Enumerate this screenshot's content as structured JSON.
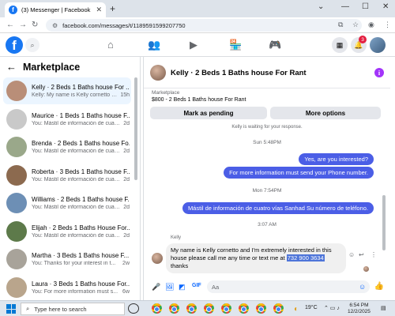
{
  "browser": {
    "tab_title": "(3) Messenger | Facebook",
    "tab_favicon": "f",
    "url": "facebook.com/messages/t/1189591599207750"
  },
  "fbnav": {
    "logo": "f",
    "notification_count": "3"
  },
  "marketplace": {
    "title": "Marketplace",
    "conversations": [
      {
        "name": "Kelly · 2 Beds 1 Baths house For ...",
        "preview": "Kelly: My name is Kelly cornetto a...",
        "time": "15h",
        "active": true,
        "avatar_color": "#b98e78"
      },
      {
        "name": "Maurice · 1 Beds 1 Baths house F...",
        "preview": "You: Mástil de información de cuatro...",
        "time": "2d",
        "active": false,
        "avatar_color": "#c9c9c9"
      },
      {
        "name": "Brenda · 2 Beds 1 Baths house Fo...",
        "preview": "You: Mástil de información de cuatro...",
        "time": "2d",
        "active": false,
        "avatar_color": "#9aa88a"
      },
      {
        "name": "Roberta · 3 Beds 1 Baths house F...",
        "preview": "You: Mástil de información de cuatro...",
        "time": "2d",
        "active": false,
        "avatar_color": "#8c6a4f"
      },
      {
        "name": "Williams · 2 Beds 1 Baths house F...",
        "preview": "You: Mástil de información de cuatro...",
        "time": "2d",
        "active": false,
        "avatar_color": "#6d8fb5"
      },
      {
        "name": "Elijah · 2 Beds 1 Baths House For...",
        "preview": "You: Mástil de información de cuatro...",
        "time": "2d",
        "active": false,
        "avatar_color": "#5d7a4a"
      },
      {
        "name": "Martha · 3 Beds 1 Baths house F...",
        "preview": "You: Thanks for your interest in t...",
        "time": "2w",
        "active": false,
        "avatar_color": "#a8a39a"
      },
      {
        "name": "Laura · 3 Beds 1 Baths house For...",
        "preview": "You: For more information must s...",
        "time": "6w",
        "active": false,
        "avatar_color": "#b9a58c"
      }
    ]
  },
  "chat": {
    "title": "Kelly · 2 Beds 1 Baths house For Rant",
    "marketplace_label": "Marketplace",
    "listing": "$800 - 2 Beds 1 Baths house For Rant",
    "mark_pending": "Mark as pending",
    "more_options": "More options",
    "waiting": "Kelly is waiting for your response.",
    "ts1": "Sun 5:48PM",
    "msg1": "Yes, are you interested?",
    "msg2": "For more information must send your Phone number.",
    "ts2": "Mon 7:54PM",
    "msg3": "Mástil de información de cuatro vías Sanhad Su número de teléfono.",
    "ts3": "3:07 AM",
    "sender": "Kelly",
    "incoming_a": "My name is Kelly cornetto and I'm extremely interested in this house please call me any time or text me at ",
    "incoming_phone": "732 900 3634",
    "incoming_b": " thanks",
    "composer_placeholder": "Aa"
  },
  "taskbar": {
    "search_placeholder": "Type here to search",
    "temperature": "19°C",
    "time": "6:54 PM",
    "date": "12/2/2025"
  }
}
